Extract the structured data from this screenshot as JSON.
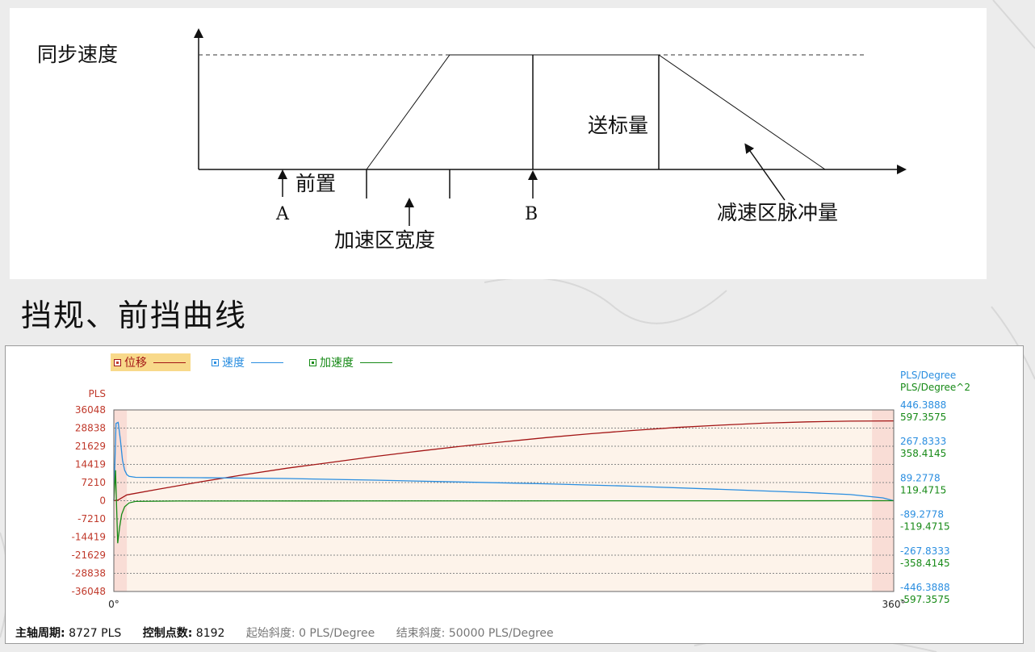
{
  "diagram": {
    "labels": {
      "sync_speed": "同步速度",
      "front_offset": "前置",
      "point_a": "A",
      "accel_width": "加速区宽度",
      "point_b": "B",
      "feed_amount": "送标量",
      "decel_pulses": "减速区脉冲量"
    }
  },
  "section_heading": "挡规、前挡曲线",
  "chart_data": {
    "type": "line",
    "legend": [
      {
        "name": "位移",
        "color": "#a31515",
        "active": true
      },
      {
        "name": "速度",
        "color": "#2a8ee0",
        "active": false
      },
      {
        "name": "加速度",
        "color": "#178a17",
        "active": false
      }
    ],
    "x_ticks": [
      "0°",
      "360°"
    ],
    "xlim": [
      0,
      360
    ],
    "left_axis": {
      "unit": "PLS",
      "color": "#c0392b",
      "ylim": [
        -36048,
        36048
      ],
      "ticks": [
        "36048",
        "28838",
        "21629",
        "14419",
        "7210",
        "0",
        "-7210",
        "-14419",
        "-21629",
        "-28838",
        "-36048"
      ]
    },
    "right_axis_velocity": {
      "unit": "PLS/Degree",
      "color": "#2a8ee0",
      "ylim": [
        -446.3888,
        446.3888
      ],
      "ticks": [
        "446.3888",
        "267.8333",
        "89.2778",
        "-89.2778",
        "-267.8333",
        "-446.3888"
      ]
    },
    "right_axis_acceleration": {
      "unit": "PLS/Degree^2",
      "color": "#178a17",
      "ylim": [
        -597.3575,
        597.3575
      ],
      "ticks": [
        "597.3575",
        "358.4145",
        "119.4715",
        "-119.4715",
        "-358.4145",
        "-597.3575"
      ]
    },
    "series": [
      {
        "name": "位移",
        "axis": "left",
        "x": [
          0,
          2,
          4,
          6,
          20,
          40,
          60,
          80,
          100,
          120,
          140,
          160,
          180,
          200,
          220,
          240,
          260,
          280,
          300,
          320,
          340,
          360
        ],
        "y": [
          0,
          300,
          1300,
          2300,
          4500,
          7500,
          10300,
          12900,
          15200,
          17500,
          19600,
          21600,
          23400,
          25100,
          26600,
          27900,
          29100,
          30000,
          30800,
          31300,
          31600,
          31700
        ]
      },
      {
        "name": "速度",
        "axis": "velocity",
        "x": [
          0,
          1,
          2,
          3,
          4,
          5,
          6,
          7,
          10,
          40,
          80,
          120,
          160,
          200,
          240,
          280,
          320,
          340,
          355,
          360
        ],
        "y": [
          0,
          380,
          385,
          300,
          200,
          150,
          128,
          120,
          115,
          113,
          109,
          101,
          92,
          83,
          71,
          56,
          40,
          30,
          14,
          0
        ]
      },
      {
        "name": "加速度",
        "axis": "acceleration",
        "x": [
          0,
          0.8,
          1.2,
          1.8,
          2.6,
          3.6,
          5,
          7,
          10,
          30,
          360
        ],
        "y": [
          0,
          200,
          0,
          -280,
          -180,
          -90,
          -40,
          -15,
          -5,
          -2,
          0
        ]
      }
    ],
    "shaded_x_ranges": [
      [
        0,
        6
      ],
      [
        350,
        360
      ]
    ]
  },
  "footer": {
    "period_label": "主轴周期:",
    "period_value": "8727 PLS",
    "points_label": "控制点数:",
    "points_value": "8192",
    "start_slope_label": "起始斜度:",
    "start_slope_value": "0 PLS/Degree",
    "end_slope_label": "结束斜度:",
    "end_slope_value": "50000 PLS/Degree"
  }
}
